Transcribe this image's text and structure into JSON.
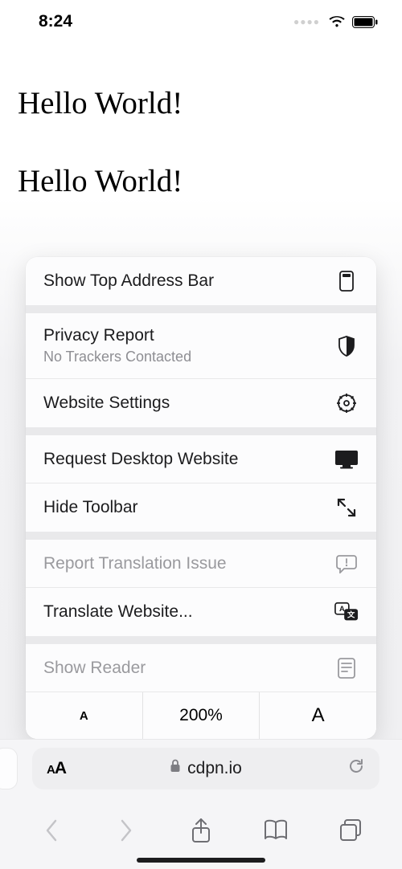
{
  "status": {
    "time": "8:24"
  },
  "page": {
    "line1": "Hello World!",
    "line2": "Hello World!"
  },
  "menu": {
    "show_top_address_bar": "Show Top Address Bar",
    "privacy_report": "Privacy Report",
    "privacy_report_sub": "No Trackers Contacted",
    "website_settings": "Website Settings",
    "request_desktop": "Request Desktop Website",
    "hide_toolbar": "Hide Toolbar",
    "report_translation": "Report Translation Issue",
    "translate_website": "Translate Website...",
    "show_reader": "Show Reader",
    "zoom_small": "A",
    "zoom_value": "200%",
    "zoom_big": "A"
  },
  "address": {
    "aa": "AA",
    "domain": "cdpn.io"
  }
}
